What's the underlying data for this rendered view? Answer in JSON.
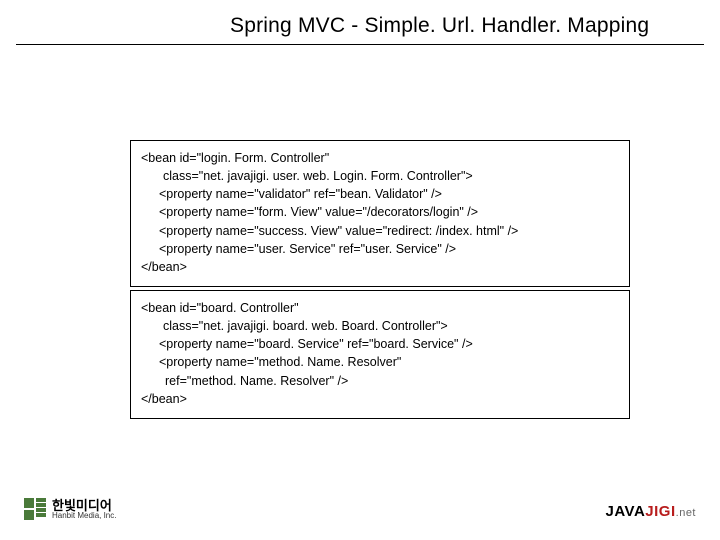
{
  "title": "Spring MVC - Simple. Url. Handler. Mapping",
  "code1": {
    "l1": "<bean id=\"login. Form. Controller\"",
    "l2": "class=\"net. javajigi. user. web. Login. Form. Controller\">",
    "l3": "<property name=\"validator\" ref=\"bean. Validator\" />",
    "l4": "<property name=\"form. View\" value=\"/decorators/login\" />",
    "l5": "<property name=\"success. View\" value=\"redirect: /index. html\" />",
    "l6": "<property name=\"user. Service\" ref=\"user. Service\" />",
    "l7": "</bean>"
  },
  "code2": {
    "l1": "<bean id=\"board. Controller\"",
    "l2": "class=\"net. javajigi. board. web. Board. Controller\">",
    "l3": "<property name=\"board. Service\" ref=\"board. Service\" />",
    "l4": "<property name=\"method. Name. Resolver\"",
    "l5": "ref=\"method. Name. Resolver\" />",
    "l6": "</bean>"
  },
  "footer": {
    "left_main": "한빛미디어",
    "left_sub": "Hanbit Media, Inc.",
    "right_java": "JAVA",
    "right_jigi": "JIGI",
    "right_net": ".net"
  }
}
